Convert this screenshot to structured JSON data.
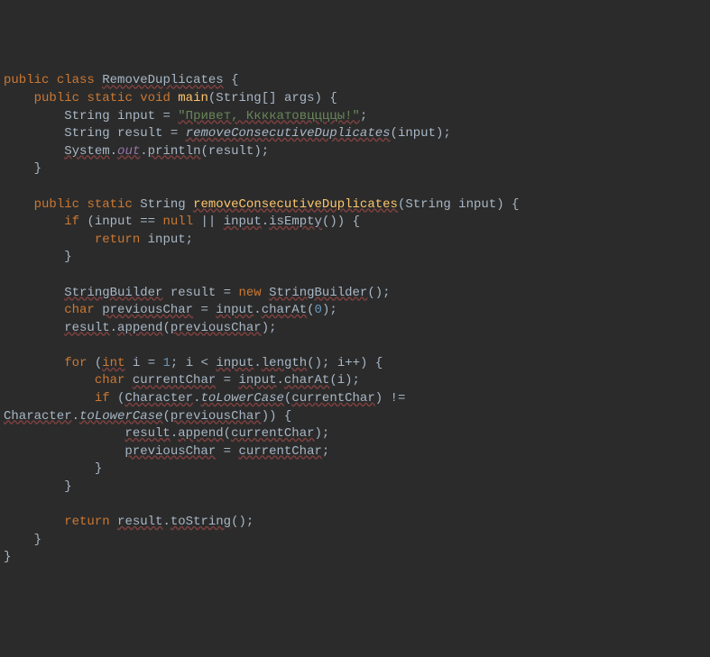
{
  "code": {
    "kw_public": "public",
    "kw_class": "class",
    "kw_static": "static",
    "kw_void": "void",
    "kw_if": "if",
    "kw_return": "return",
    "kw_new": "new",
    "kw_char": "char",
    "kw_for": "for",
    "kw_int": "int",
    "kw_null": "null",
    "class_RemoveDuplicates": "RemoveDuplicates",
    "type_String": "String",
    "type_StringBuilder": "StringBuilder",
    "type_Character": "Character",
    "method_main": "main",
    "method_removeConsecutiveDuplicates": "removeConsecutiveDuplicates",
    "method_println": "println",
    "method_isEmpty": "isEmpty",
    "method_charAt": "charAt",
    "method_append": "append",
    "method_length": "length",
    "method_toLowerCase": "toLowerCase",
    "method_toString": "toString",
    "field_out": "out",
    "ident_args": "args",
    "ident_input": "input",
    "ident_result": "result",
    "ident_previousChar": "previousChar",
    "ident_currentChar": "currentChar",
    "ident_i": "i",
    "ident_System": "System",
    "string_literal": "\"Привет, Ккккатовццццы!\"",
    "num_0": "0",
    "num_1": "1",
    "op_eq": "=",
    "op_semi": ";",
    "op_lbrace": "{",
    "op_rbrace": "}",
    "op_lparen": "(",
    "op_rparen": ")",
    "op_lbracket": "[",
    "op_rbracket": "]",
    "op_comma": ",",
    "op_dot": ".",
    "op_eqeq": "==",
    "op_oror": "||",
    "op_lt": "<",
    "op_inc": "++",
    "op_neq": "!="
  }
}
